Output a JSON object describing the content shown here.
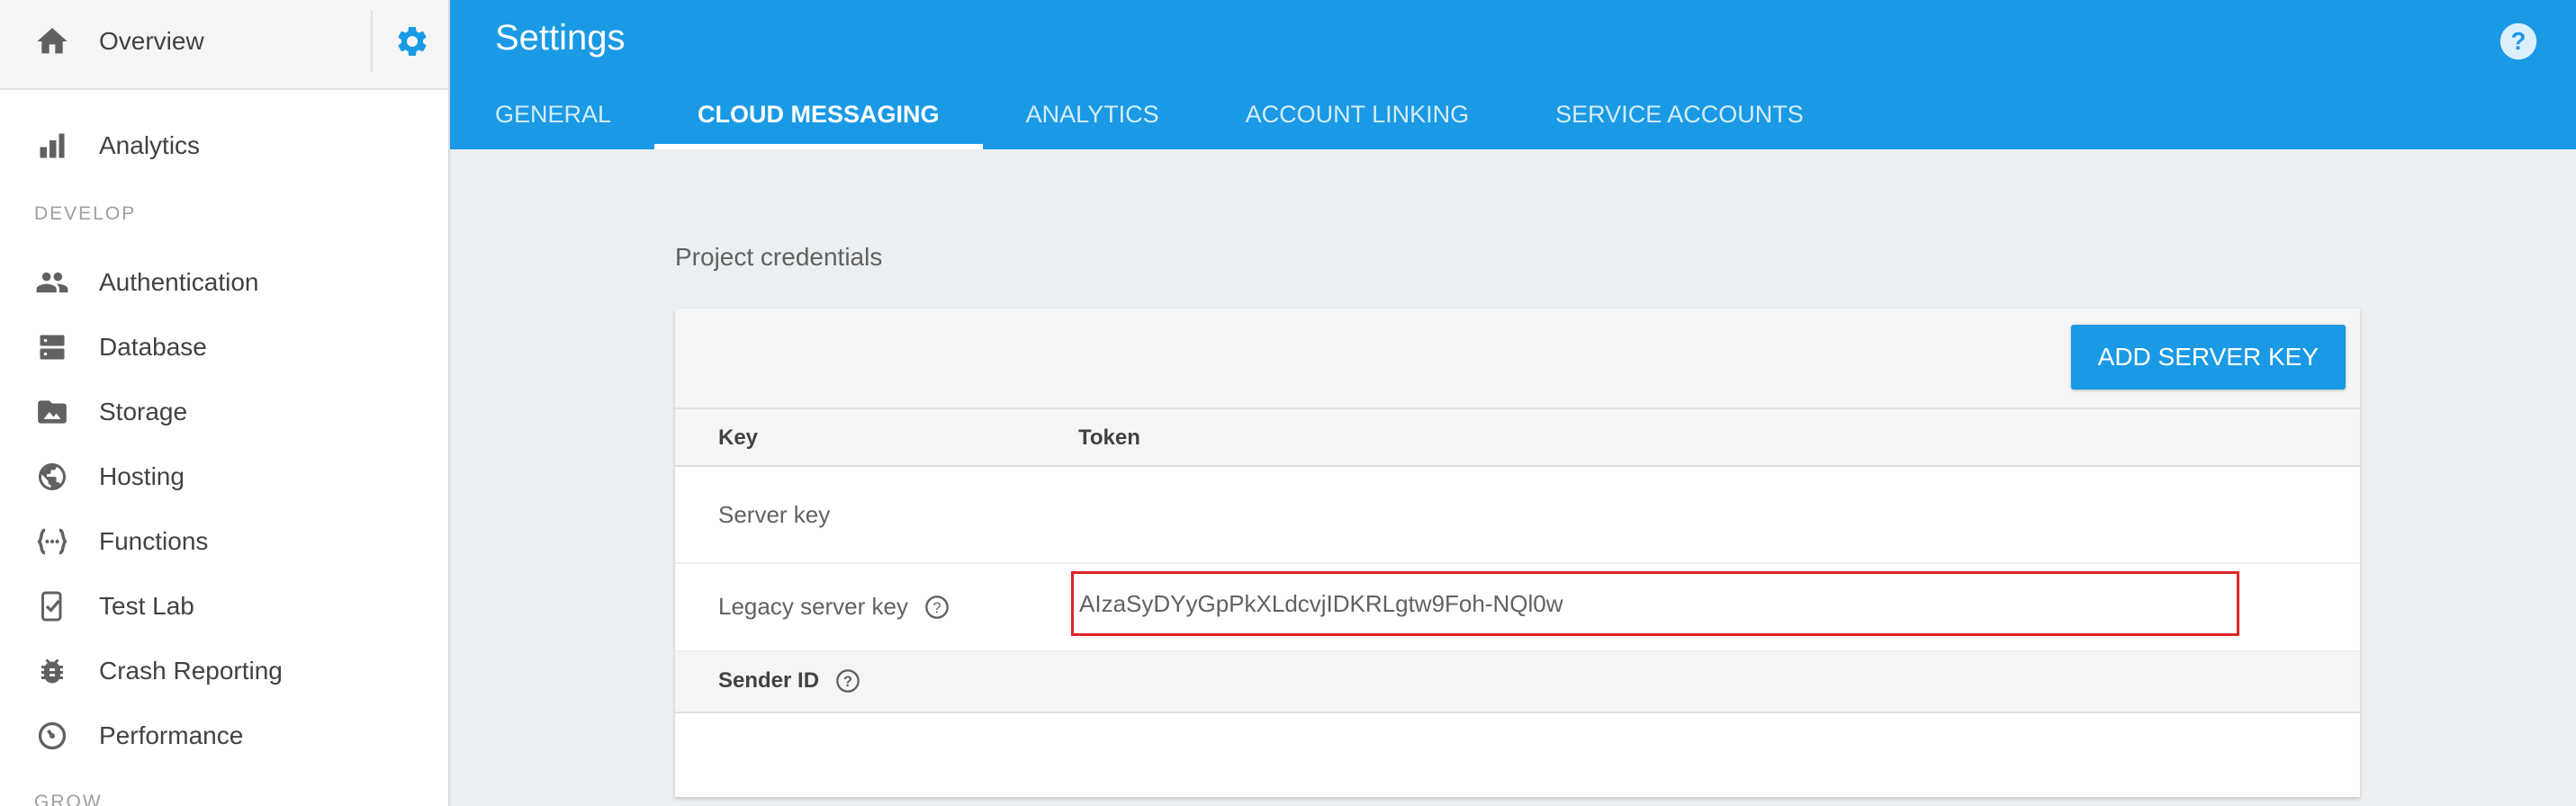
{
  "sidebar": {
    "overview_label": "Overview",
    "analytics_label": "Analytics",
    "develop_section": "DEVELOP",
    "grow_section": "GROW",
    "items": [
      {
        "label": "Authentication",
        "icon": "people-icon"
      },
      {
        "label": "Database",
        "icon": "database-icon"
      },
      {
        "label": "Storage",
        "icon": "image-icon"
      },
      {
        "label": "Hosting",
        "icon": "globe-icon"
      },
      {
        "label": "Functions",
        "icon": "functions-icon"
      },
      {
        "label": "Test Lab",
        "icon": "test-lab-icon"
      },
      {
        "label": "Crash Reporting",
        "icon": "bug-icon"
      },
      {
        "label": "Performance",
        "icon": "gauge-icon"
      }
    ]
  },
  "header": {
    "title": "Settings",
    "tabs": [
      {
        "label": "GENERAL",
        "active": false
      },
      {
        "label": "CLOUD MESSAGING",
        "active": true
      },
      {
        "label": "ANALYTICS",
        "active": false
      },
      {
        "label": "ACCOUNT LINKING",
        "active": false
      },
      {
        "label": "SERVICE ACCOUNTS",
        "active": false
      }
    ]
  },
  "main": {
    "section_title": "Project credentials",
    "add_server_key_label": "ADD SERVER KEY",
    "columns": {
      "key": "Key",
      "token": "Token"
    },
    "rows": [
      {
        "key": "Server key",
        "token": ""
      },
      {
        "key": "Legacy server key",
        "token": "AIzaSyDYyGpPkXLdcvjIDKRLgtw9Foh-NQl0w"
      }
    ],
    "sender_id_label": "Sender ID"
  },
  "colors": {
    "accent": "#1a9ae5",
    "highlight_border": "#e02424",
    "sidebar_icon": "#616161"
  }
}
